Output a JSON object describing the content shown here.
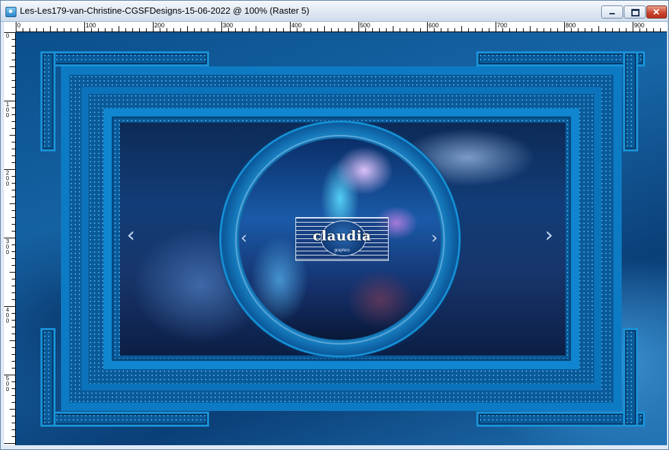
{
  "window": {
    "title": "Les-Les179-van-Christine-CGSFDesigns-15-06-2022 @ 100% (Raster 5)",
    "app_icon": "psp-image-icon",
    "controls": {
      "minimize_icon": "minimize-icon",
      "maximize_icon": "maximize-icon",
      "close_icon": "close-icon",
      "close_glyph": "✕"
    }
  },
  "ruler_top": {
    "labels": [
      "0",
      "100",
      "200",
      "300",
      "400",
      "500",
      "600",
      "700",
      "800",
      "900"
    ]
  },
  "ruler_left": {
    "labels": [
      "0",
      "1 0 0",
      "2 0 0",
      "3 0 0",
      "4 0 0",
      "5 0 0"
    ]
  },
  "image": {
    "logo_text": "claudia",
    "logo_sub": "graphics",
    "nav_left_glyph": "‹",
    "nav_right_glyph": "›",
    "colors": {
      "frame_light": "#0f86cf",
      "frame_dark": "#0a5a99",
      "background": "#0c4d86"
    }
  }
}
